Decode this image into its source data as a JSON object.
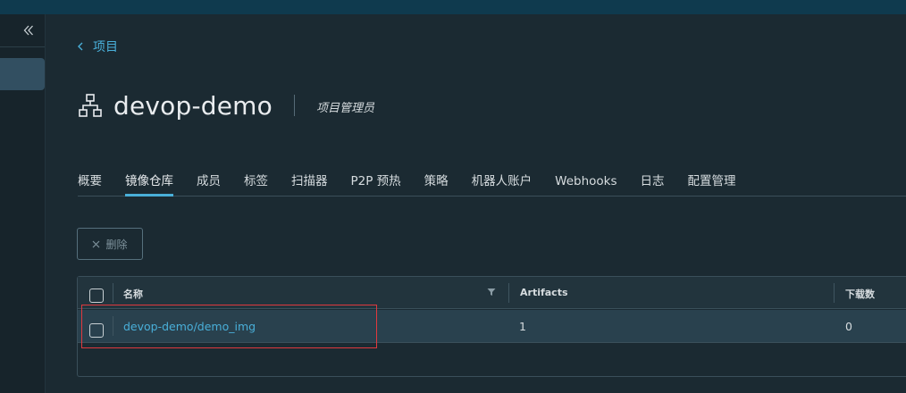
{
  "header": {
    "back_link": "项目",
    "project_name": "devop-demo",
    "role": "项目管理员"
  },
  "icons": {
    "collapse": "double-chevron-left-icon",
    "back": "chevron-left-icon",
    "project": "network-hierarchy-icon",
    "delete": "close-icon",
    "filter": "filter-icon"
  },
  "tabs": [
    {
      "label": "概要",
      "active": false
    },
    {
      "label": "镜像仓库",
      "active": true
    },
    {
      "label": "成员",
      "active": false
    },
    {
      "label": "标签",
      "active": false
    },
    {
      "label": "扫描器",
      "active": false
    },
    {
      "label": "P2P 预热",
      "active": false
    },
    {
      "label": "策略",
      "active": false
    },
    {
      "label": "机器人账户",
      "active": false
    },
    {
      "label": "Webhooks",
      "active": false
    },
    {
      "label": "日志",
      "active": false
    },
    {
      "label": "配置管理",
      "active": false
    }
  ],
  "toolbar": {
    "delete_label": "删除"
  },
  "table": {
    "columns": [
      "名称",
      "Artifacts",
      "下载数"
    ],
    "rows": [
      {
        "name": "devop-demo/demo_img",
        "artifacts": "1",
        "pulls": "0"
      }
    ]
  },
  "colors": {
    "accent": "#49afd9",
    "background": "#1b2a32",
    "topbar": "#0f3a4e",
    "highlight_box": "#e0393e"
  }
}
